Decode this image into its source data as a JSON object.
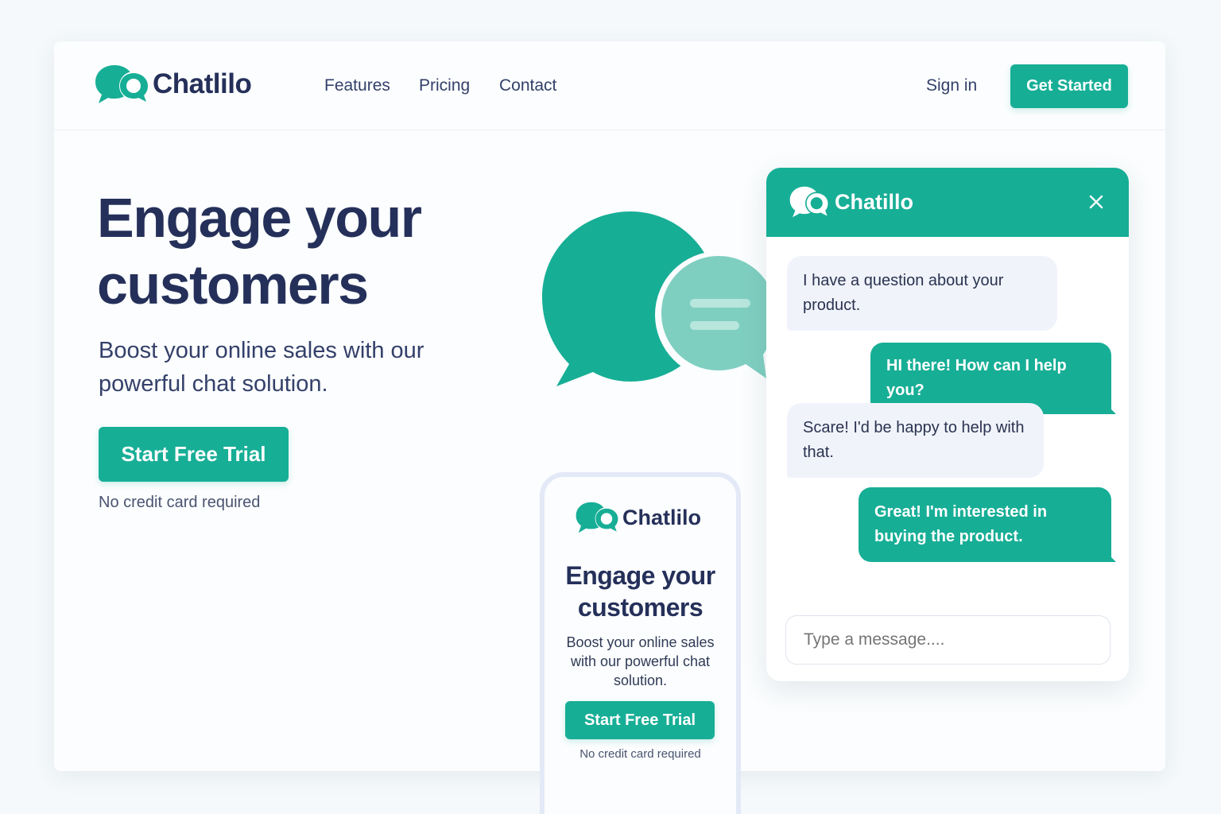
{
  "colors": {
    "brand": "#17ae96",
    "brand_light": "#7fcfc1",
    "heading": "#25305a",
    "background": "#f5f9fb"
  },
  "nav": {
    "brand": "Chatlilo",
    "links": [
      "Features",
      "Pricing",
      "Contact"
    ],
    "sign_in": "Sign in",
    "cta": "Get Started"
  },
  "hero": {
    "title": "Engage your customers",
    "subtitle": "Boost your online sales with our powerful chat solution.",
    "cta": "Start Free Trial",
    "note": "No credit card required"
  },
  "illustration": {
    "icon": "chat-bubbles-icon"
  },
  "phone": {
    "brand": "Chatlilo",
    "title": "Engage your customers",
    "subtitle": "Boost your online sales with our powerful chat solution.",
    "cta": "Start Free Trial",
    "note": "No credit card required"
  },
  "widget": {
    "brand": "Chatillo",
    "close_icon": "close-icon",
    "messages": [
      {
        "from": "customer",
        "text": "I have a question about your product."
      },
      {
        "from": "agent",
        "text": "HI there! How can I help you?"
      },
      {
        "from": "customer",
        "text": "Scare! I'd be happy to help with that."
      },
      {
        "from": "agent",
        "text": "Great! I'm interested in buying the product."
      }
    ],
    "input_placeholder": "Type a message...."
  }
}
